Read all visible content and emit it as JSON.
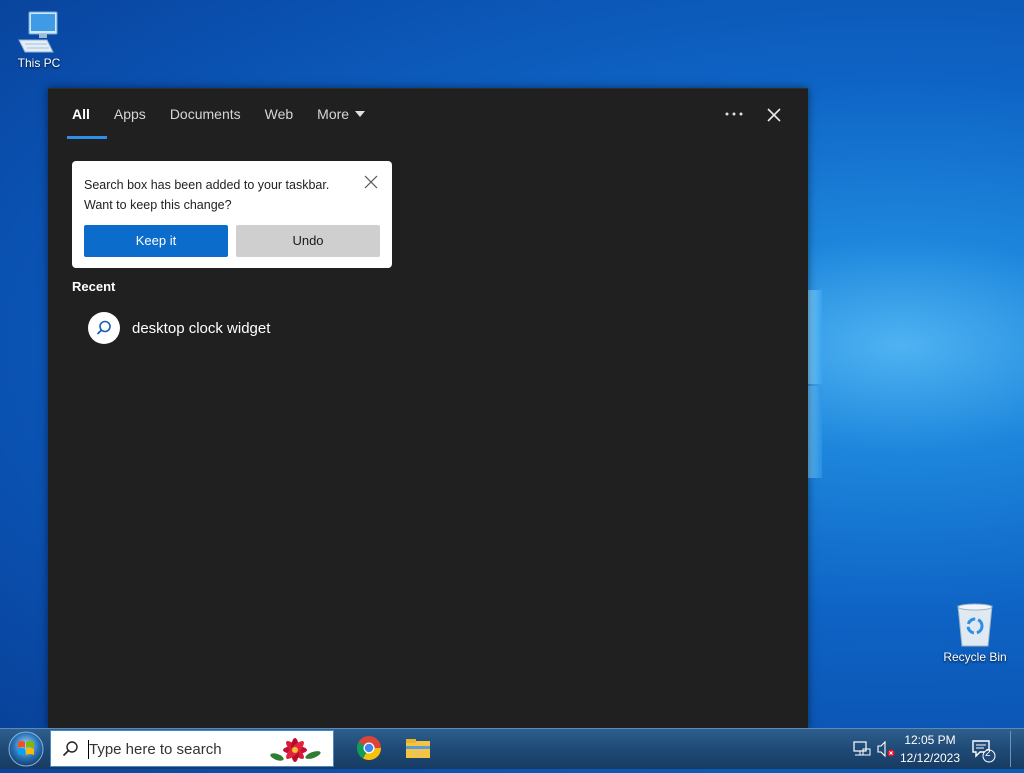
{
  "desktop": {
    "icons": [
      {
        "label": "This PC"
      },
      {
        "label": "Recycle Bin"
      }
    ]
  },
  "search_panel": {
    "tabs": [
      "All",
      "Apps",
      "Documents",
      "Web",
      "More"
    ],
    "active_tab": "All",
    "more_icon": "ellipsis-icon",
    "close_icon": "close-icon"
  },
  "toast": {
    "line1": "Search box has been added to your taskbar.",
    "line2": "Want to keep this change?",
    "keep_label": "Keep it",
    "undo_label": "Undo"
  },
  "recent": {
    "heading": "Recent",
    "items": [
      {
        "label": "desktop clock widget",
        "icon": "search-icon"
      }
    ]
  },
  "taskbar": {
    "search_placeholder": "Type here to search",
    "apps": [
      "chrome-icon",
      "file-explorer-icon"
    ],
    "time": "12:05 PM",
    "date": "12/12/2023",
    "notification_count": "2"
  },
  "colors": {
    "accent": "#0b6ccc",
    "panel_bg": "#202020",
    "tab_underline": "#2f8ee8"
  }
}
